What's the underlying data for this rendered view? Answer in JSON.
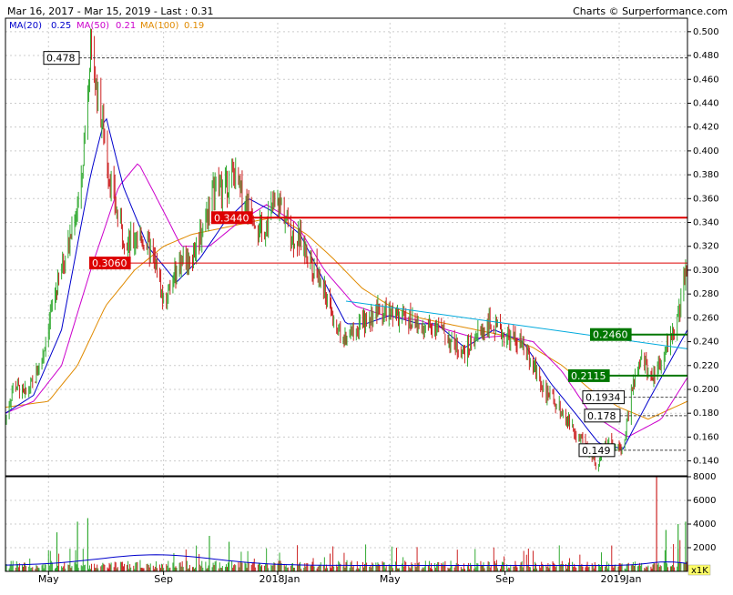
{
  "header": {
    "date_range": "Mar 16, 2017 - Mar 15, 2019 - Last : 0.31",
    "credit": "Charts © Surperformance.com"
  },
  "legend": [
    {
      "label": "MA(20)",
      "value": "0.25",
      "color": "#0000cc"
    },
    {
      "label": "MA(50)",
      "value": "0.21",
      "color": "#cc00cc"
    },
    {
      "label": "MA(100)",
      "value": "0.19",
      "color": "#e08a00"
    }
  ],
  "colors": {
    "up_bar": "#33aa33",
    "down_bar": "#cc2222",
    "resistance": "#dd0000",
    "support": "#007700",
    "trendline": "#00aadd",
    "ref_line": "#444444",
    "grid": "#cccccc",
    "avg_volume": "#0000cc"
  },
  "chart_data": {
    "type": "line",
    "title": "",
    "x_ticks": [
      "May",
      "Sep",
      "2018Jan",
      "May",
      "Sep",
      "2019Jan"
    ],
    "y_ticks": [
      "0.500",
      "0.480",
      "0.460",
      "0.440",
      "0.420",
      "0.400",
      "0.380",
      "0.360",
      "0.340",
      "0.320",
      "0.300",
      "0.280",
      "0.260",
      "0.240",
      "0.220",
      "0.200",
      "0.180",
      "0.160",
      "0.140"
    ],
    "ylim": [
      0.1275,
      0.5075
    ],
    "x_range": [
      "2017-03-16",
      "2019-03-15"
    ],
    "last": 0.31,
    "price_path": [
      [
        "2017-03-16",
        0.175
      ],
      [
        "2017-03-25",
        0.205
      ],
      [
        "2017-04-05",
        0.195
      ],
      [
        "2017-04-15",
        0.205
      ],
      [
        "2017-04-25",
        0.23
      ],
      [
        "2017-05-05",
        0.27
      ],
      [
        "2017-05-15",
        0.3
      ],
      [
        "2017-05-25",
        0.33
      ],
      [
        "2017-06-05",
        0.37
      ],
      [
        "2017-06-10",
        0.43
      ],
      [
        "2017-06-14",
        0.48
      ],
      [
        "2017-06-20",
        0.46
      ],
      [
        "2017-06-28",
        0.42
      ],
      [
        "2017-07-05",
        0.38
      ],
      [
        "2017-07-15",
        0.34
      ],
      [
        "2017-07-25",
        0.32
      ],
      [
        "2017-08-05",
        0.33
      ],
      [
        "2017-08-15",
        0.32
      ],
      [
        "2017-08-25",
        0.3
      ],
      [
        "2017-09-02",
        0.27
      ],
      [
        "2017-09-10",
        0.29
      ],
      [
        "2017-09-20",
        0.31
      ],
      [
        "2017-10-01",
        0.31
      ],
      [
        "2017-10-15",
        0.34
      ],
      [
        "2017-10-25",
        0.37
      ],
      [
        "2017-11-05",
        0.37
      ],
      [
        "2017-11-15",
        0.38
      ],
      [
        "2017-11-25",
        0.36
      ],
      [
        "2017-12-05",
        0.35
      ],
      [
        "2017-12-15",
        0.33
      ],
      [
        "2017-12-25",
        0.35
      ],
      [
        "2018-01-05",
        0.355
      ],
      [
        "2018-01-15",
        0.33
      ],
      [
        "2018-01-25",
        0.325
      ],
      [
        "2018-02-05",
        0.31
      ],
      [
        "2018-02-15",
        0.29
      ],
      [
        "2018-02-25",
        0.27
      ],
      [
        "2018-03-05",
        0.25
      ],
      [
        "2018-03-15",
        0.24
      ],
      [
        "2018-03-25",
        0.25
      ],
      [
        "2018-04-05",
        0.255
      ],
      [
        "2018-04-15",
        0.265
      ],
      [
        "2018-04-25",
        0.265
      ],
      [
        "2018-05-05",
        0.26
      ],
      [
        "2018-05-20",
        0.26
      ],
      [
        "2018-06-05",
        0.25
      ],
      [
        "2018-06-20",
        0.255
      ],
      [
        "2018-07-05",
        0.24
      ],
      [
        "2018-07-20",
        0.23
      ],
      [
        "2018-08-01",
        0.245
      ],
      [
        "2018-08-15",
        0.255
      ],
      [
        "2018-09-01",
        0.245
      ],
      [
        "2018-09-15",
        0.24
      ],
      [
        "2018-09-25",
        0.23
      ],
      [
        "2018-10-05",
        0.215
      ],
      [
        "2018-10-15",
        0.195
      ],
      [
        "2018-10-25",
        0.19
      ],
      [
        "2018-11-05",
        0.175
      ],
      [
        "2018-11-15",
        0.165
      ],
      [
        "2018-11-25",
        0.155
      ],
      [
        "2018-12-05",
        0.14
      ],
      [
        "2018-12-10",
        0.135
      ],
      [
        "2018-12-20",
        0.16
      ],
      [
        "2018-12-28",
        0.15
      ],
      [
        "2019-01-05",
        0.15
      ],
      [
        "2019-01-15",
        0.2
      ],
      [
        "2019-01-25",
        0.225
      ],
      [
        "2019-02-05",
        0.21
      ],
      [
        "2019-02-15",
        0.225
      ],
      [
        "2019-02-25",
        0.245
      ],
      [
        "2019-03-05",
        0.26
      ],
      [
        "2019-03-15",
        0.31
      ]
    ],
    "ma20": [
      [
        "2017-03-16",
        0.18
      ],
      [
        "2017-04-15",
        0.195
      ],
      [
        "2017-05-15",
        0.25
      ],
      [
        "2017-06-15",
        0.38
      ],
      [
        "2017-07-01",
        0.43
      ],
      [
        "2017-07-20",
        0.37
      ],
      [
        "2017-08-15",
        0.32
      ],
      [
        "2017-09-15",
        0.29
      ],
      [
        "2017-10-10",
        0.31
      ],
      [
        "2017-11-05",
        0.34
      ],
      [
        "2017-12-01",
        0.36
      ],
      [
        "2017-12-25",
        0.35
      ],
      [
        "2018-01-25",
        0.33
      ],
      [
        "2018-02-20",
        0.29
      ],
      [
        "2018-03-15",
        0.255
      ],
      [
        "2018-04-05",
        0.255
      ],
      [
        "2018-05-01",
        0.262
      ],
      [
        "2018-06-01",
        0.255
      ],
      [
        "2018-06-20",
        0.255
      ],
      [
        "2018-07-20",
        0.235
      ],
      [
        "2018-08-20",
        0.25
      ],
      [
        "2018-09-20",
        0.24
      ],
      [
        "2018-10-20",
        0.205
      ],
      [
        "2018-11-15",
        0.18
      ],
      [
        "2018-12-10",
        0.155
      ],
      [
        "2019-01-05",
        0.15
      ],
      [
        "2019-02-01",
        0.19
      ],
      [
        "2019-03-15",
        0.25
      ]
    ],
    "ma50": [
      [
        "2017-03-16",
        0.18
      ],
      [
        "2017-04-15",
        0.19
      ],
      [
        "2017-05-15",
        0.22
      ],
      [
        "2017-06-15",
        0.3
      ],
      [
        "2017-07-15",
        0.37
      ],
      [
        "2017-08-05",
        0.39
      ],
      [
        "2017-08-25",
        0.36
      ],
      [
        "2017-09-20",
        0.32
      ],
      [
        "2017-10-20",
        0.32
      ],
      [
        "2017-11-20",
        0.34
      ],
      [
        "2017-12-20",
        0.355
      ],
      [
        "2018-01-20",
        0.34
      ],
      [
        "2018-02-20",
        0.3
      ],
      [
        "2018-03-25",
        0.27
      ],
      [
        "2018-04-25",
        0.262
      ],
      [
        "2018-06-01",
        0.258
      ],
      [
        "2018-07-01",
        0.25
      ],
      [
        "2018-08-01",
        0.243
      ],
      [
        "2018-09-01",
        0.245
      ],
      [
        "2018-10-01",
        0.24
      ],
      [
        "2018-11-01",
        0.215
      ],
      [
        "2018-12-01",
        0.18
      ],
      [
        "2019-01-10",
        0.16
      ],
      [
        "2019-02-15",
        0.175
      ],
      [
        "2019-03-15",
        0.21
      ]
    ],
    "ma100": [
      [
        "2017-03-16",
        0.185
      ],
      [
        "2017-05-01",
        0.19
      ],
      [
        "2017-06-01",
        0.22
      ],
      [
        "2017-07-01",
        0.27
      ],
      [
        "2017-08-01",
        0.3
      ],
      [
        "2017-09-01",
        0.32
      ],
      [
        "2017-10-01",
        0.33
      ],
      [
        "2017-11-01",
        0.335
      ],
      [
        "2017-12-01",
        0.34
      ],
      [
        "2018-01-01",
        0.345
      ],
      [
        "2018-02-01",
        0.33
      ],
      [
        "2018-03-01",
        0.31
      ],
      [
        "2018-04-01",
        0.285
      ],
      [
        "2018-05-01",
        0.27
      ],
      [
        "2018-06-01",
        0.26
      ],
      [
        "2018-07-01",
        0.255
      ],
      [
        "2018-08-01",
        0.25
      ],
      [
        "2018-09-01",
        0.245
      ],
      [
        "2018-10-01",
        0.235
      ],
      [
        "2018-11-01",
        0.22
      ],
      [
        "2018-12-01",
        0.2
      ],
      [
        "2019-01-01",
        0.185
      ],
      [
        "2019-02-01",
        0.175
      ],
      [
        "2019-03-15",
        0.19
      ]
    ],
    "levels": [
      {
        "label": "0.478",
        "value": 0.478,
        "kind": "ref"
      },
      {
        "label": "0.3440",
        "value": 0.344,
        "kind": "resistance"
      },
      {
        "label": "0.3060",
        "value": 0.306,
        "kind": "resistance"
      },
      {
        "label": "0.2460",
        "value": 0.246,
        "kind": "support"
      },
      {
        "label": "0.2115",
        "value": 0.2115,
        "kind": "support"
      },
      {
        "label": "0.1934",
        "value": 0.1934,
        "kind": "ref"
      },
      {
        "label": "0.178",
        "value": 0.178,
        "kind": "ref"
      },
      {
        "label": "0.149",
        "value": 0.149,
        "kind": "ref"
      }
    ],
    "trendline": [
      [
        "2018-03-15",
        0.274
      ],
      [
        "2019-03-15",
        0.234
      ]
    ],
    "volume": {
      "unit": "x1K",
      "ylim": [
        0,
        8000
      ],
      "y_ticks": [
        "8000",
        "6000",
        "4000",
        "2000"
      ],
      "spikes": [
        [
          "2017-06-01",
          4200
        ],
        [
          "2017-06-12",
          4500
        ],
        [
          "2017-05-10",
          3300
        ],
        [
          "2017-10-20",
          3000
        ],
        [
          "2017-11-10",
          2500
        ],
        [
          "2019-02-10",
          8000
        ],
        [
          "2019-02-20",
          3500
        ],
        [
          "2019-03-05",
          4000
        ],
        [
          "2019-03-13",
          4200
        ]
      ]
    }
  }
}
